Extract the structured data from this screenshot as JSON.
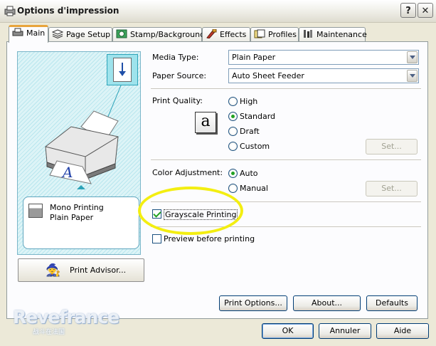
{
  "window": {
    "title": "Options d'impression",
    "help_glyph": "?",
    "close_glyph": "✕"
  },
  "tabs": [
    {
      "label": "Main",
      "icon": "printer-icon",
      "active": true
    },
    {
      "label": "Page Setup",
      "icon": "layers-icon"
    },
    {
      "label": "Stamp/Background",
      "icon": "stamp-icon"
    },
    {
      "label": "Effects",
      "icon": "brush-icon"
    },
    {
      "label": "Profiles",
      "icon": "folder-icon"
    },
    {
      "label": "Maintenance",
      "icon": "tools-icon"
    }
  ],
  "preview": {
    "line1": "Mono Printing",
    "line2": "Plain Paper"
  },
  "print_advisor": {
    "label": "Print Advisor..."
  },
  "media_type": {
    "label": "Media Type:",
    "value": "Plain Paper"
  },
  "paper_source": {
    "label": "Paper Source:",
    "value": "Auto Sheet Feeder"
  },
  "print_quality": {
    "label": "Print Quality:",
    "icon_glyph": "a",
    "options": [
      "High",
      "Standard",
      "Draft",
      "Custom"
    ],
    "selected": "Standard",
    "set_label": "Set..."
  },
  "color_adjustment": {
    "label": "Color Adjustment:",
    "options": [
      "Auto",
      "Manual"
    ],
    "selected": "Auto",
    "set_label": "Set..."
  },
  "grayscale_printing": {
    "label": "Grayscale Printing",
    "checked": true
  },
  "preview_before_printing": {
    "label": "Preview before printing",
    "checked": false
  },
  "bottom_buttons": {
    "print_options": "Print Options...",
    "about": "About...",
    "defaults": "Defaults"
  },
  "dialog_buttons": {
    "ok": "OK",
    "cancel": "Annuler",
    "help": "Aide"
  },
  "watermark": {
    "main": "Revefrance",
    "sub": "战斗在法国"
  },
  "colors": {
    "highlight_ellipse": "#F3EE11",
    "active_tab_accent": "#E8A43C",
    "preview_cyan": "#9EE3EC"
  }
}
